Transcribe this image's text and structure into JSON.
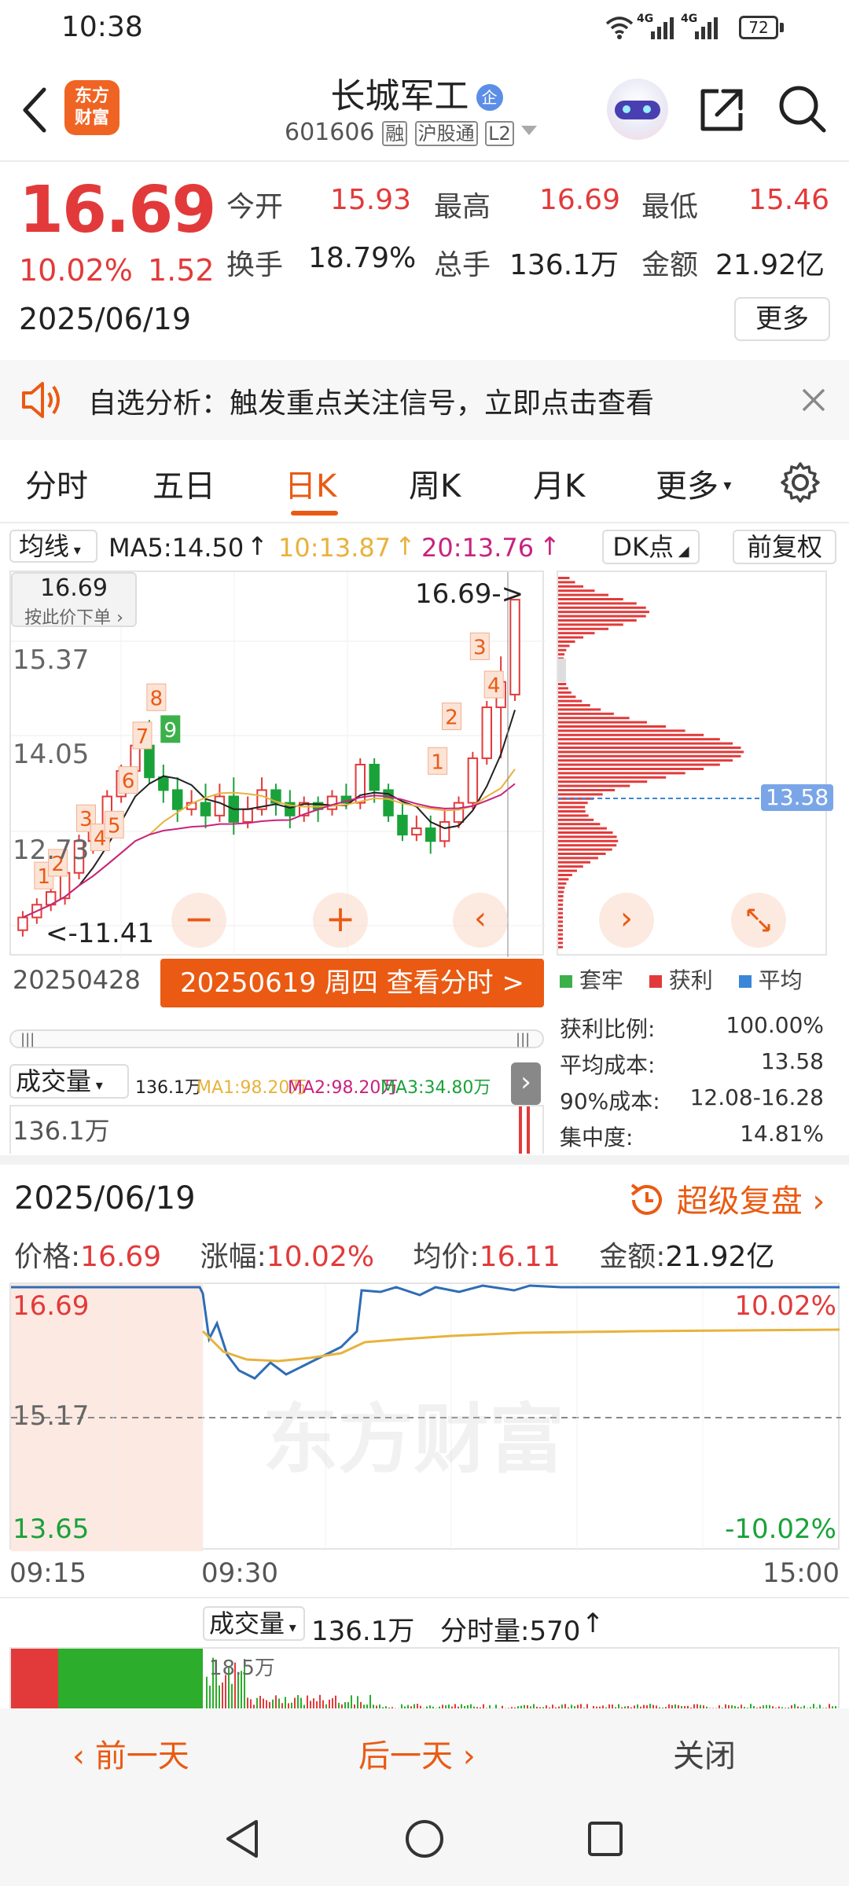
{
  "status_bar": {
    "time": "10:38",
    "signal1": "4G",
    "signal2": "4G",
    "battery": "72"
  },
  "header": {
    "app_logo_line1": "东方",
    "app_logo_line2": "财富",
    "stock_name": "长城军工",
    "badge": "企",
    "code": "601606",
    "tags": [
      "融",
      "沪股通",
      "L2"
    ]
  },
  "quote": {
    "price": "16.69",
    "change_pct": "10.02%",
    "change": "1.52",
    "date": "2025/06/19",
    "fields": {
      "open_label": "今开",
      "open": "15.93",
      "high_label": "最高",
      "high": "16.69",
      "low_label": "最低",
      "low": "15.46",
      "turnover_label": "换手",
      "turnover": "18.79%",
      "volume_label": "总手",
      "volume": "136.1万",
      "amount_label": "金额",
      "amount": "21.92亿"
    },
    "more_button": "更多"
  },
  "notice": {
    "text": "自选分析：触发重点关注信号，立即点击查看"
  },
  "tabs": [
    {
      "label": "分时",
      "active": false
    },
    {
      "label": "五日",
      "active": false
    },
    {
      "label": "日K",
      "active": true
    },
    {
      "label": "周K",
      "active": false
    },
    {
      "label": "月K",
      "active": false
    },
    {
      "label": "更多",
      "active": false
    }
  ],
  "kline": {
    "indicator_select": "均线",
    "ma5": "MA5:14.50",
    "ma10": "10:13.87",
    "ma20": "20:13.76",
    "dk_button": "DK点",
    "adjust_button": "前复权",
    "price_tip": "16.69",
    "price_tip_sub": "按此价下单",
    "levels": [
      "15.37",
      "14.05",
      "12.73",
      "11.41"
    ],
    "max_label": "16.69->",
    "min_label": "<-11.41",
    "start_date": "20250428",
    "selected_banner": "20250619 周四 查看分时 >",
    "markers": [
      "1",
      "2",
      "3",
      "4",
      "5",
      "6",
      "7",
      "8",
      "9",
      "1",
      "2",
      "3",
      "4"
    ],
    "chip_avg": "13.58"
  },
  "chips": {
    "legend": [
      "套牢",
      "获利",
      "平均"
    ],
    "rows": [
      {
        "label": "获利比例:",
        "value": "100.00%"
      },
      {
        "label": "平均成本:",
        "value": "13.58"
      },
      {
        "label": "90%成本:",
        "value": "12.08-16.28"
      },
      {
        "label": "集中度:",
        "value": "14.81%"
      }
    ]
  },
  "volume_panel": {
    "select": "成交量",
    "total": "136.1万",
    "ma1": "MA1:98.20万",
    "ma2": "MA2:98.20万",
    "ma3": "MA3:34.80万",
    "axis_value": "136.1万"
  },
  "intraday": {
    "date": "2025/06/19",
    "replay_label": "超级复盘",
    "price_label": "价格:",
    "price": "16.69",
    "pct_label": "涨幅:",
    "pct": "10.02%",
    "avg_label": "均价:",
    "avg": "16.11",
    "amount_label": "金额:",
    "amount": "21.92亿",
    "y_top": "16.69",
    "y_mid": "15.17",
    "y_bottom": "13.65",
    "pct_top": "10.02%",
    "pct_bottom": "-10.02%",
    "time_start": "09:15",
    "time_open": "09:30",
    "time_end": "15:00",
    "watermark": "东方财富",
    "vol_select": "成交量",
    "vol_total": "136.1万",
    "minute_vol_label": "分时量:570",
    "vol_axis": "18.5万"
  },
  "footer": {
    "prev": "前一天",
    "next": "后一天",
    "close": "关闭"
  },
  "colors": {
    "up": "#e23a3a",
    "down": "#1aa23a",
    "accent": "#ea5a13",
    "avg_line": "#e8b23c",
    "price_line": "#2f6db5"
  }
}
